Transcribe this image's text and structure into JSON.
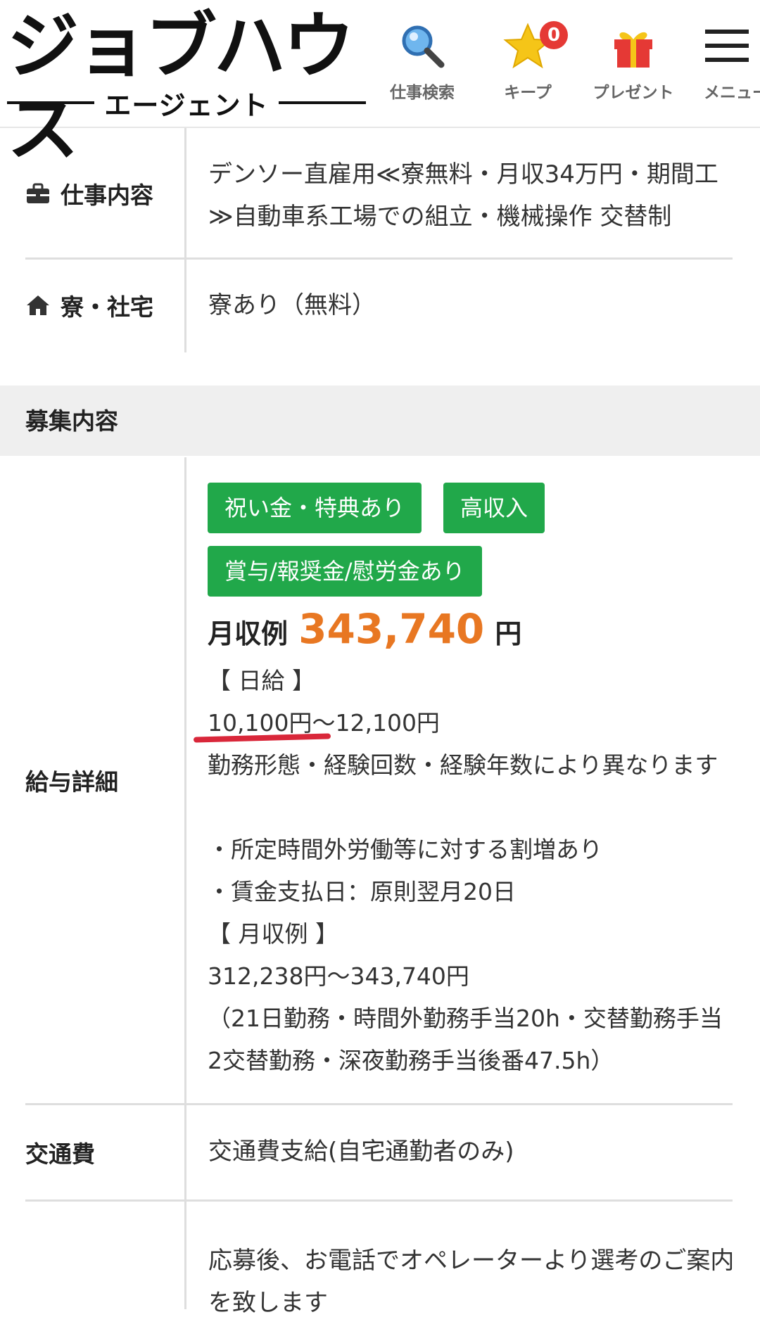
{
  "header": {
    "logo_main": "ジョブハウス",
    "logo_sub": "エージェント",
    "nav": {
      "search_label": "仕事検索",
      "keep_label": "キープ",
      "keep_count": "0",
      "present_label": "プレゼント",
      "menu_label": "メニュー"
    }
  },
  "rows": {
    "job": {
      "label": "仕事内容",
      "value": "デンソー直雇用≪寮無料・月収34万円・期間工≫自動車系工場での組立・機械操作 交替制"
    },
    "dorm": {
      "label": "寮・社宅",
      "value": "寮あり（無料）"
    }
  },
  "section": {
    "title": "募集内容"
  },
  "salary": {
    "label": "給与詳細",
    "tags": [
      "祝い金・特典あり",
      "高収入",
      "賞与/報奨金/慰労金あり"
    ],
    "example_prefix": "月収例",
    "example_amount": "343,740",
    "example_unit": "円",
    "lines": [
      "【 日給 】",
      "10,100円〜12,100円",
      "勤務形態・経験回数・経験年数により異なります",
      "・所定時間外労働等に対する割増あり",
      "・賃金支払日：原則翌月20日",
      "【 月収例 】",
      "312,238円〜343,740円",
      "（21日勤務・時間外勤務手当20h・交替勤務手当2交替勤務・深夜勤務手当後番47.5h）"
    ]
  },
  "transport": {
    "label": "交通費",
    "value": "交通費支給(自宅通勤者のみ)"
  },
  "apply": {
    "value": "応募後、お電話でオペレーターより選考のご案内を致します"
  },
  "colors": {
    "tag_green": "#21a84a",
    "salary_orange": "#e87722",
    "badge_red": "#e53935",
    "underline_red": "#d9273a"
  }
}
